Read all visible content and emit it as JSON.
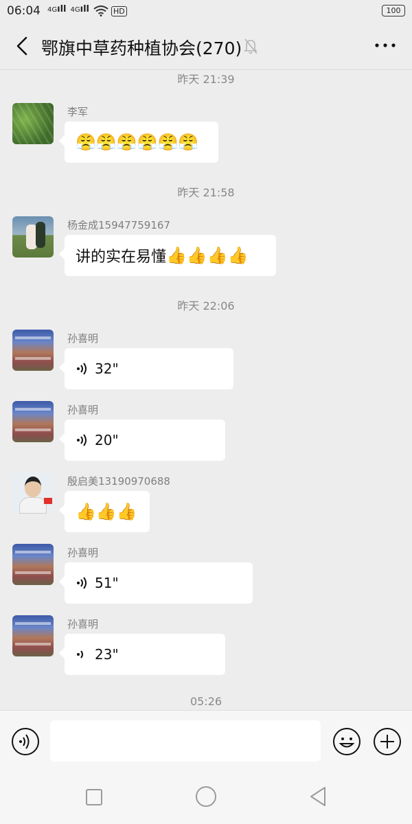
{
  "status_bar": {
    "time": "06:04",
    "signal1": "4G",
    "signal2": "4G",
    "network": "HD",
    "battery": "100"
  },
  "header": {
    "title": "鄂旗中草药种植协会(270)"
  },
  "timestamps": [
    "昨天 21:39",
    "昨天 21:58",
    "昨天 22:06",
    "05:26"
  ],
  "messages": [
    {
      "sender": "李军",
      "emoji": "😤😤😤😤😤😤"
    },
    {
      "sender": "杨金成15947759167",
      "text": "讲的实在易懂",
      "emoji": "👍👍👍👍"
    },
    {
      "sender": "孙喜明",
      "voice": "32\""
    },
    {
      "sender": "孙喜明",
      "voice": "20\""
    },
    {
      "sender": "殷启美13190970688",
      "emoji": "👍👍👍"
    },
    {
      "sender": "孙喜明",
      "voice": "51\""
    },
    {
      "sender": "孙喜明",
      "voice": "23\""
    }
  ],
  "input": {
    "value": ""
  }
}
